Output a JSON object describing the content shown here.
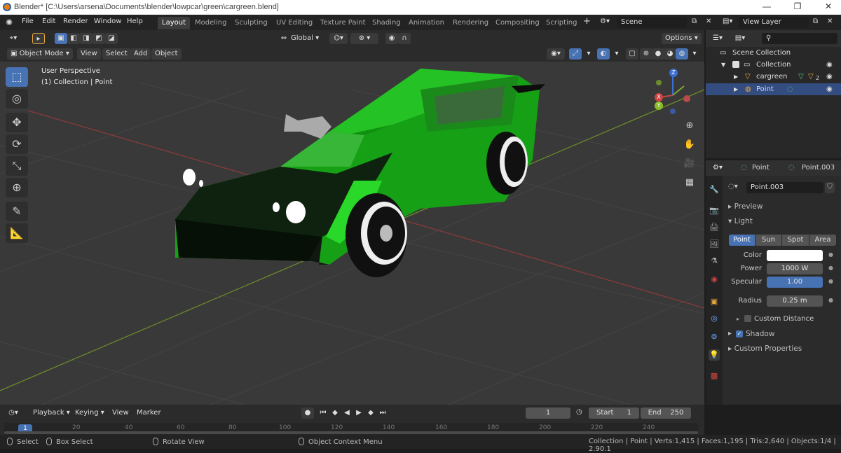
{
  "window": {
    "title": "Blender* [C:\\Users\\arsena\\Documents\\blender\\lowpcar\\green\\cargreen.blend]",
    "min": "—",
    "max": "❐",
    "close": "✕"
  },
  "menu": {
    "file": "File",
    "edit": "Edit",
    "render": "Render",
    "window": "Window",
    "help": "Help"
  },
  "workspaces": [
    "Layout",
    "Modeling",
    "Sculpting",
    "UV Editing",
    "Texture Paint",
    "Shading",
    "Animation",
    "Rendering",
    "Compositing",
    "Scripting"
  ],
  "scene": {
    "name": "Scene",
    "view_layer": "View Layer"
  },
  "header": {
    "transform_orientation": "Global",
    "options": "Options"
  },
  "viewport_menu": {
    "mode": "Object Mode",
    "view": "View",
    "select": "Select",
    "add": "Add",
    "object": "Object"
  },
  "overlay_text": {
    "perspective": "User Perspective",
    "collection": "(1) Collection | Point"
  },
  "gizmo": {
    "x": "X",
    "y": "Y",
    "z": "Z"
  },
  "outliner": {
    "search_placeholder": "",
    "scene_collection": "Scene Collection",
    "collection": "Collection",
    "cargreen": "cargreen",
    "cargreen_badge": "2",
    "point": "Point"
  },
  "properties": {
    "object_name": "Point",
    "data_name": "Point.003",
    "datablock": "Point.003",
    "panels": {
      "preview": "Preview",
      "light": "Light",
      "custom_distance": "Custom Distance",
      "shadow": "Shadow",
      "custom_properties": "Custom Properties"
    },
    "light_types": [
      "Point",
      "Sun",
      "Spot",
      "Area"
    ],
    "active_light_type": "Point",
    "color_label": "Color",
    "color_value": "#ffffff",
    "power_label": "Power",
    "power": "1000 W",
    "specular_label": "Specular",
    "specular": "1.00",
    "radius_label": "Radius",
    "radius": "0.25 m"
  },
  "timeline": {
    "playback": "Playback",
    "keying": "Keying",
    "view": "View",
    "marker": "Marker",
    "current_frame": "1",
    "start_label": "Start",
    "start": "1",
    "end_label": "End",
    "end": "250",
    "ruler": [
      "1",
      "20",
      "40",
      "60",
      "80",
      "100",
      "120",
      "140",
      "160",
      "180",
      "200",
      "220",
      "240"
    ]
  },
  "status": {
    "select": "Select",
    "box_select": "Box Select",
    "rotate_view": "Rotate View",
    "context_menu": "Object Context Menu",
    "stats": "Collection | Point | Verts:1,415 | Faces:1,195 | Tris:2,640 | Objects:1/4 | 2.90.1"
  },
  "colors": {
    "accent": "#4772b3",
    "car_green": "#1fa31f",
    "car_dark": "#0f200f",
    "x_axis": "#b84a4a",
    "y_axis": "#7ba831"
  }
}
